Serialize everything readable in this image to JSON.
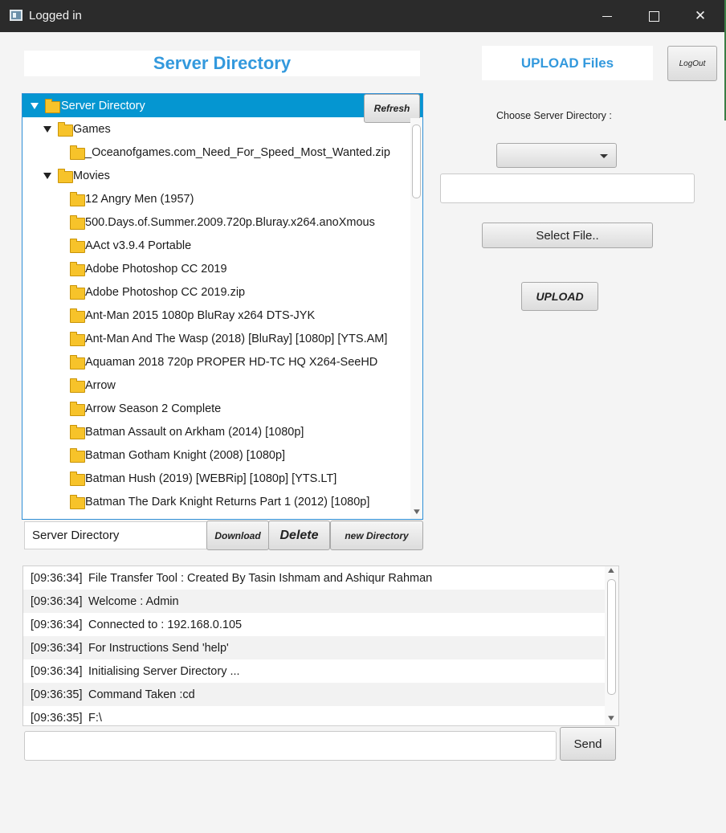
{
  "window": {
    "title": "Logged in"
  },
  "header": {
    "server_title": "Server Directory",
    "upload_title": "UPLOAD Files",
    "logout_label": "LogOut"
  },
  "tree": {
    "refresh_label": "Refresh",
    "items": [
      {
        "label": "Server Directory",
        "level": 0,
        "expanded": true,
        "selected": true
      },
      {
        "label": "Games",
        "level": 1,
        "expanded": true
      },
      {
        "label": "_Oceanofgames.com_Need_For_Speed_Most_Wanted.zip",
        "level": 2
      },
      {
        "label": "Movies",
        "level": 1,
        "expanded": true
      },
      {
        "label": "12 Angry Men (1957)",
        "level": 2
      },
      {
        "label": "500.Days.of.Summer.2009.720p.Bluray.x264.anoXmous",
        "level": 2
      },
      {
        "label": "AAct v3.9.4 Portable",
        "level": 2
      },
      {
        "label": "Adobe Photoshop CC 2019",
        "level": 2
      },
      {
        "label": "Adobe Photoshop CC 2019.zip",
        "level": 2
      },
      {
        "label": "Ant-Man 2015 1080p BluRay x264 DTS-JYK",
        "level": 2
      },
      {
        "label": "Ant-Man And The Wasp (2018) [BluRay] [1080p] [YTS.AM]",
        "level": 2
      },
      {
        "label": "Aquaman 2018 720p PROPER HD-TC HQ X264-SeeHD",
        "level": 2
      },
      {
        "label": "Arrow",
        "level": 2
      },
      {
        "label": "Arrow Season 2 Complete",
        "level": 2
      },
      {
        "label": "Batman Assault on Arkham (2014) [1080p]",
        "level": 2
      },
      {
        "label": "Batman Gotham Knight (2008) [1080p]",
        "level": 2
      },
      {
        "label": "Batman Hush (2019) [WEBRip] [1080p] [YTS.LT]",
        "level": 2
      },
      {
        "label": "Batman The Dark Knight Returns Part 1 (2012) [1080p]",
        "level": 2
      }
    ]
  },
  "actions": {
    "path_value": "Server Directory",
    "download_label": "Download",
    "delete_label": "Delete",
    "new_directory_label": "new Directory"
  },
  "upload": {
    "choose_label": "Choose Server Directory :",
    "combo_value": "",
    "file_value": "",
    "select_file_label": "Select File..",
    "upload_label": "UPLOAD"
  },
  "log": {
    "entries": [
      {
        "time": "[09:36:34]",
        "message": "File Transfer Tool : Created By Tasin Ishmam and Ashiqur Rahman"
      },
      {
        "time": "[09:36:34]",
        "message": "Welcome : Admin"
      },
      {
        "time": "[09:36:34]",
        "message": "Connected to : 192.168.0.105"
      },
      {
        "time": "[09:36:34]",
        "message": "For Instructions Send 'help'"
      },
      {
        "time": "[09:36:34]",
        "message": "Initialising Server Directory ..."
      },
      {
        "time": "[09:36:35]",
        "message": "Command Taken :cd"
      },
      {
        "time": "[09:36:35]",
        "message": "F:\\"
      }
    ]
  },
  "command": {
    "input_value": "",
    "send_label": "Send"
  },
  "colors": {
    "accent": "#3399dd",
    "selection": "#0596d1",
    "folder": "#f7c32a",
    "titlebar": "#2b2b2b"
  }
}
